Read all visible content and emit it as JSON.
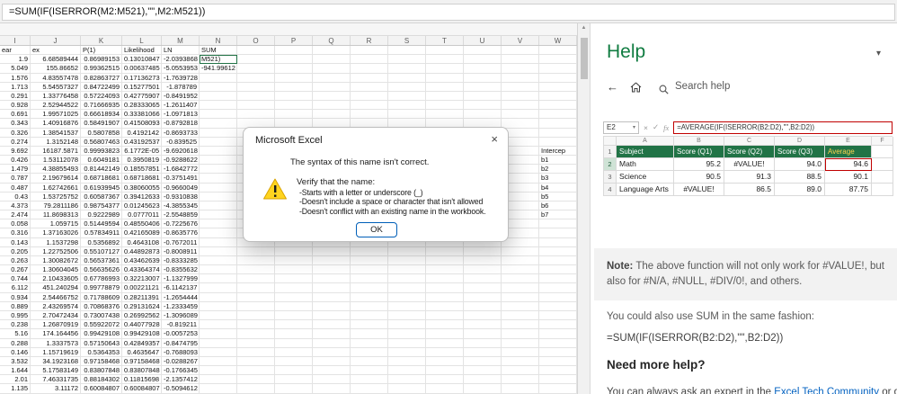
{
  "formula_bar": {
    "formula": "=SUM(IF(ISERROR(M2:M521),\"\",M2:M521))"
  },
  "icons": {
    "close": "×",
    "back": "←",
    "caret": "▾",
    "check": "✓",
    "cancel": "×",
    "up_arrow": "▲"
  },
  "colors": {
    "excel_green": "#217346",
    "help_green": "#107C41",
    "error_red": "#c00000",
    "focus_blue": "#005fb8"
  },
  "sheet": {
    "columns": [
      "I",
      "J",
      "K",
      "L",
      "M",
      "N",
      "O",
      "P",
      "Q",
      "R",
      "S",
      "T",
      "U",
      "V",
      "W"
    ],
    "header_row": [
      "ear",
      "ex",
      "P(1)",
      "Likelihood",
      "LN",
      "SUM"
    ],
    "active_cell_text": "M521)",
    "sum_result": "-941.99612",
    "side_labels": [
      "Intercep",
      "b1",
      "b2",
      "b3",
      "b4",
      "b5",
      "b6",
      "b7"
    ],
    "rows": [
      [
        "1.9",
        "6.68589444",
        "0.86989153",
        "0.13010847",
        "-2.0393868"
      ],
      [
        "5.049",
        "155.86652",
        "0.99362515",
        "0.00637485",
        "-5.0553953"
      ],
      [
        "1.576",
        "4.83557478",
        "0.82863727",
        "0.17136273",
        "-1.7639728"
      ],
      [
        "1.713",
        "5.54557327",
        "0.84722499",
        "0.15277501",
        "-1.878789"
      ],
      [
        "0.291",
        "1.33776458",
        "0.57224093",
        "0.42775907",
        "-0.8491952"
      ],
      [
        "0.928",
        "2.52944522",
        "0.71666935",
        "0.28333065",
        "-1.2611407"
      ],
      [
        "0.691",
        "1.99571025",
        "0.66618934",
        "0.33381066",
        "-1.0971813"
      ],
      [
        "0.343",
        "1.40916876",
        "0.58491907",
        "0.41508093",
        "-0.8792818"
      ],
      [
        "0.326",
        "1.38541537",
        "0.5807858",
        "0.4192142",
        "-0.8693733"
      ],
      [
        "0.274",
        "1.3152148",
        "0.56807463",
        "0.43192537",
        "-0.839525"
      ],
      [
        "9.692",
        "16187.5871",
        "0.99993823",
        "6.1772E-05",
        "-9.6920618"
      ],
      [
        "0.426",
        "1.53112078",
        "0.6049181",
        "0.3950819",
        "-0.9288622"
      ],
      [
        "1.479",
        "4.38855493",
        "0.81442149",
        "0.18557851",
        "-1.6842772"
      ],
      [
        "0.787",
        "2.19679614",
        "0.68718681",
        "0.68718681",
        "-0.3751491"
      ],
      [
        "0.487",
        "1.62742661",
        "0.61939945",
        "0.38060055",
        "-0.9660049"
      ],
      [
        "0.43",
        "1.53725752",
        "0.60587367",
        "0.39412633",
        "-0.9310838"
      ],
      [
        "4.373",
        "79.2811186",
        "0.98754377",
        "0.01245623",
        "-4.3855345"
      ],
      [
        "2.474",
        "11.8698313",
        "0.9222989",
        "0.0777011",
        "-2.5548859"
      ],
      [
        "0.058",
        "1.059715",
        "0.51449594",
        "0.48550406",
        "-0.7225676"
      ],
      [
        "0.316",
        "1.37163026",
        "0.57834911",
        "0.42165089",
        "-0.8635776"
      ],
      [
        "0.143",
        "1.1537298",
        "0.5356892",
        "0.4643108",
        "-0.7672011"
      ],
      [
        "0.205",
        "1.22752506",
        "0.55107127",
        "0.44892873",
        "-0.8008911"
      ],
      [
        "0.263",
        "1.30082672",
        "0.56537361",
        "0.43462639",
        "-0.8333285"
      ],
      [
        "0.267",
        "1.30604045",
        "0.56635626",
        "0.43364374",
        "-0.8355632"
      ],
      [
        "0.744",
        "2.10433605",
        "0.67786993",
        "0.32213007",
        "-1.1327999"
      ],
      [
        "6.112",
        "451.240294",
        "0.99778879",
        "0.00221121",
        "-6.1142137"
      ],
      [
        "0.934",
        "2.54466752",
        "0.71788609",
        "0.28211391",
        "-1.2654444"
      ],
      [
        "0.889",
        "2.43269574",
        "0.70868376",
        "0.29131624",
        "-1.2333459"
      ],
      [
        "0.995",
        "2.70472434",
        "0.73007438",
        "0.26992562",
        "-1.3096089"
      ],
      [
        "0.238",
        "1.26870919",
        "0.55922072",
        "0.44077928",
        "-0.819211"
      ],
      [
        "5.16",
        "174.164456",
        "0.99429108",
        "0.99429108",
        "-0.0057253"
      ],
      [
        "0.288",
        "1.3337573",
        "0.57150643",
        "0.42849357",
        "-0.8474795"
      ],
      [
        "0.146",
        "1.15719619",
        "0.5364353",
        "0.4635647",
        "-0.7688093"
      ],
      [
        "3.532",
        "34.1923168",
        "0.97158468",
        "0.97158468",
        "-0.0288267"
      ],
      [
        "1.644",
        "5.17583149",
        "0.83807848",
        "0.83807848",
        "-0.1766345"
      ],
      [
        "2.01",
        "7.46331735",
        "0.88184302",
        "0.11815698",
        "-2.1357412"
      ],
      [
        "1.135",
        "3.11172",
        "0.60084807",
        "0.60084807",
        "-0.5094612"
      ]
    ]
  },
  "dialog": {
    "title": "Microsoft Excel",
    "message": "The syntax of this name isn't correct.",
    "verify_heading": "Verify that the name:",
    "verify_items": [
      "-Starts with a letter or underscore (_)",
      "-Doesn't include a space or character that isn't allowed",
      "-Doesn't conflict with an existing name in the workbook."
    ],
    "ok_label": "OK"
  },
  "help": {
    "title": "Help",
    "search_placeholder": "Search help",
    "example": {
      "name_box": "E2",
      "fx_label": "fx",
      "formula": "=AVERAGE(IF(ISERROR(B2:D2),\"\",B2:D2))",
      "columns": [
        "A",
        "B",
        "C",
        "D",
        "E",
        "F"
      ],
      "table": {
        "headers": [
          "Subject",
          "Score (Q1)",
          "Score (Q2)",
          "Score (Q3)",
          "Average"
        ],
        "rows": [
          [
            "Math",
            "95.2",
            "#VALUE!",
            "94.0",
            "94.6"
          ],
          [
            "Science",
            "90.5",
            "91.3",
            "88.5",
            "90.1"
          ],
          [
            "Language Arts",
            "#VALUE!",
            "86.5",
            "89.0",
            "87.75"
          ]
        ]
      }
    },
    "note_label": "Note:",
    "note_text": " The above function will not only work for #VALUE!, but also for #N/A, #NULL, #DIV/0!, and others.",
    "sum_intro": "You could also use SUM in the same fashion:",
    "sum_formula": "=SUM(IF(ISERROR(B2:D2),\"\",B2:D2))",
    "more_help": "Need more help?",
    "footer_prefix": "You can always ask an expert in the ",
    "footer_link": "Excel Tech Community",
    "footer_suffix": " or get support in Communities."
  }
}
